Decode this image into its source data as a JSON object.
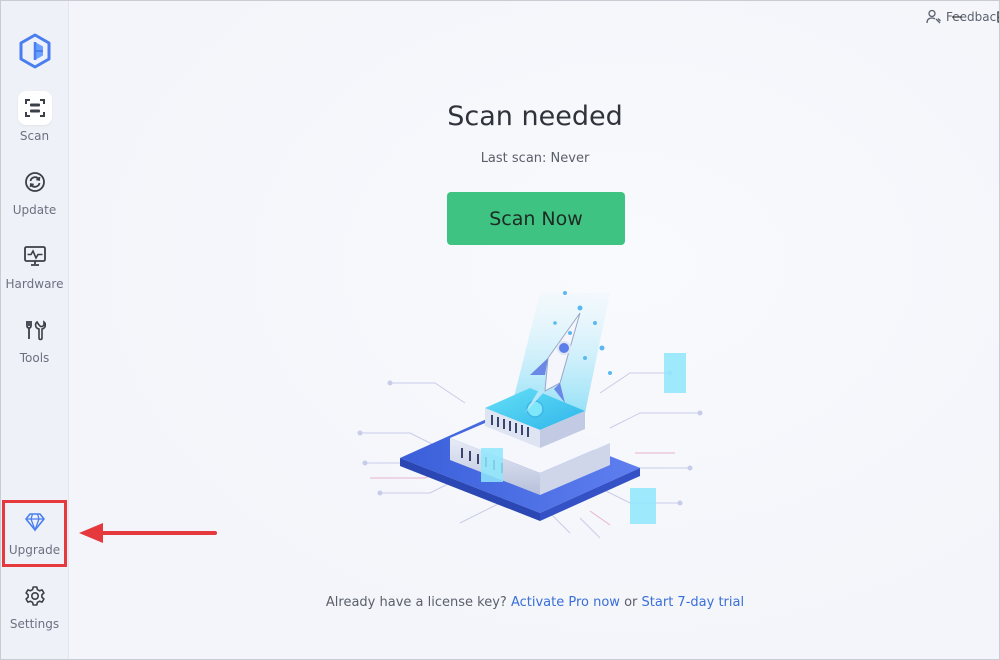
{
  "titlebar": {
    "feedback_label": "Feedback"
  },
  "sidebar": {
    "items": [
      {
        "label": "Scan",
        "icon": "scan-icon",
        "active": true
      },
      {
        "label": "Update",
        "icon": "update-icon"
      },
      {
        "label": "Hardware",
        "icon": "monitor-pulse-icon"
      },
      {
        "label": "Tools",
        "icon": "tools-icon"
      },
      {
        "label": "Upgrade",
        "icon": "diamond-icon",
        "highlighted": true
      },
      {
        "label": "Settings",
        "icon": "gear-icon"
      }
    ]
  },
  "main": {
    "heading": "Scan needed",
    "last_scan": "Last scan: Never",
    "scan_button": "Scan Now",
    "footer": {
      "prefix": "Already have a license key?",
      "activate_link": "Activate Pro now",
      "or": "or",
      "trial_link": "Start 7-day trial"
    }
  },
  "colors": {
    "accent_green": "#3ec383",
    "link_blue": "#3a6fd8",
    "highlight_red": "#e5393d",
    "logo_blue": "#4a7ef0"
  }
}
